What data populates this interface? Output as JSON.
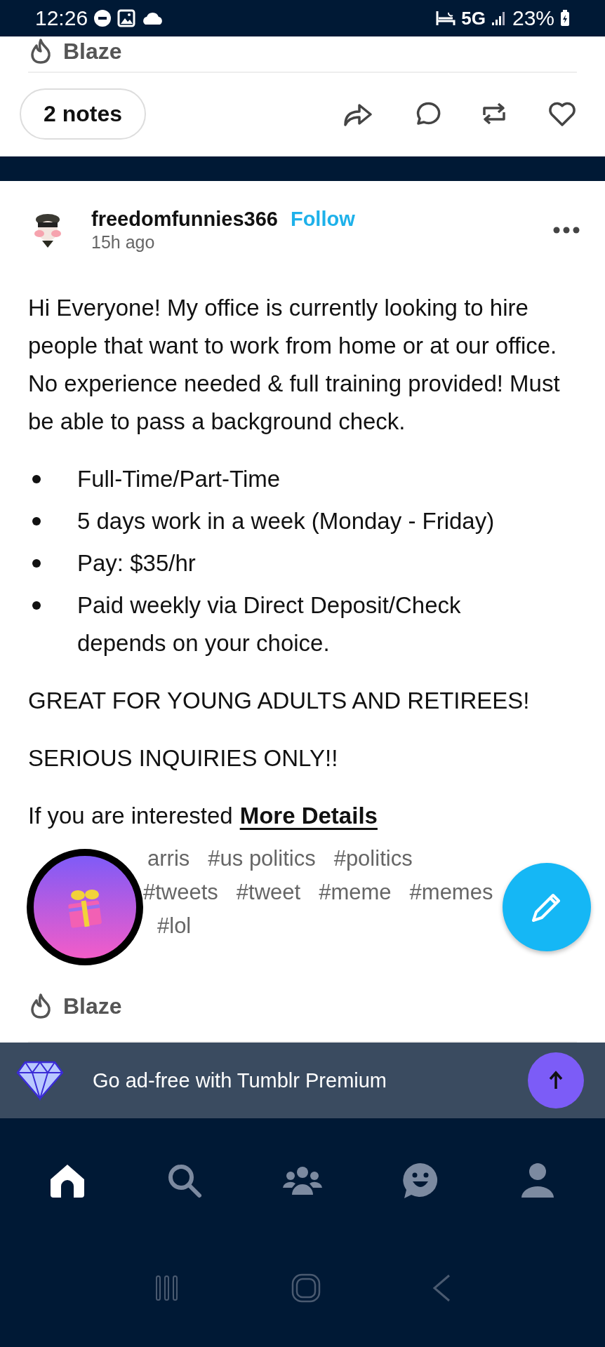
{
  "status_bar": {
    "time": "12:26",
    "network": "5G",
    "battery": "23%"
  },
  "previous_post": {
    "blaze": "Blaze",
    "notes": "2 notes"
  },
  "post": {
    "username": "freedomfunnies366",
    "follow": "Follow",
    "time": "15h ago",
    "paragraphs": [
      "Hi Everyone! My office is currently looking to hire people that want to work from home or at our office. No experience needed & full training provided! Must be able to pass a background check."
    ],
    "bullets": [
      "Full-Time/Part-Time",
      "5 days work in a week (Monday - Friday)",
      "Pay: $35/hr",
      "Paid weekly via Direct Deposit/Check depends on your choice."
    ],
    "after": [
      "GREAT FOR YOUNG ADULTS AND RETIREES!",
      "SERIOUS INQUIRIES ONLY!!"
    ],
    "link_intro": "If you are interested",
    "link": "More Details",
    "tag_rows": [
      [
        "arris",
        "#us politics",
        "#politics"
      ],
      [
        "#tweets",
        "#tweet",
        "#meme",
        "#memes"
      ],
      [
        "#lol"
      ]
    ],
    "blaze": "Blaze"
  },
  "banner": {
    "text": "Go ad-free with Tumblr Premium"
  },
  "nav": [
    {
      "kind": "home",
      "selected": true
    },
    {
      "kind": "search",
      "selected": false
    },
    {
      "kind": "community",
      "selected": false
    },
    {
      "kind": "chat",
      "selected": false
    },
    {
      "kind": "account",
      "selected": false
    }
  ]
}
